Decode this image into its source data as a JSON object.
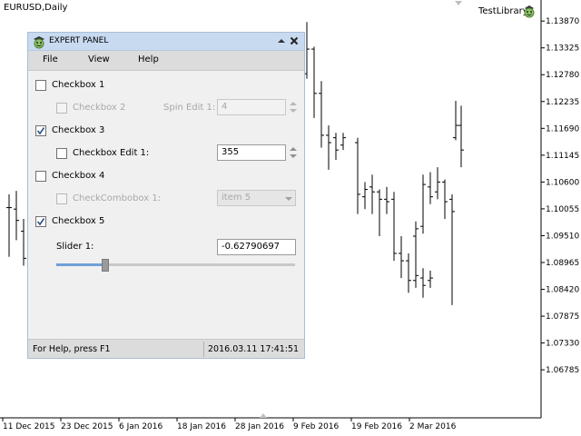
{
  "chart": {
    "symbol_label": "EURUSD,Daily",
    "library_label": "TestLibrary",
    "library_icon": "smiley-icon",
    "price_labels": [
      "1.13870",
      "1.13325",
      "1.12780",
      "1.12235",
      "1.11690",
      "1.11145",
      "1.10600",
      "1.10055",
      "1.09510",
      "1.08965",
      "1.08420",
      "1.07875",
      "1.07330",
      "1.06785"
    ],
    "date_labels": [
      "11 Dec 2015",
      "23 Dec 2015",
      "6 Jan 2016",
      "18 Jan 2016",
      "28 Jan 2016",
      "9 Feb 2016",
      "19 Feb 2016",
      "2 Mar 2016"
    ]
  },
  "chart_data": {
    "type": "ohlc",
    "title": "EURUSD,Daily",
    "ylim": [
      1.064,
      1.1415
    ],
    "x": [
      "11 Dec 2015",
      "23 Dec 2015",
      "6 Jan 2016",
      "18 Jan 2016",
      "28 Jan 2016",
      "9 Feb 2016",
      "19 Feb 2016",
      "2 Mar 2016"
    ],
    "bars": [
      {
        "o": 1.1008,
        "h": 1.1035,
        "l": 1.0908,
        "c": 1.1008
      },
      {
        "o": 1.1005,
        "h": 1.1042,
        "l": 1.0942,
        "c": 1.0982
      },
      {
        "o": 1.096,
        "h": 1.0985,
        "l": 1.089,
        "c": 1.0905
      },
      {
        "o": 1.09,
        "h": 1.096,
        "l": 1.088,
        "c": 1.0915
      },
      {
        "o": 1.079,
        "h": 1.081,
        "l": 1.0712,
        "c": 1.0735
      },
      {
        "o": 1.0745,
        "h": 1.079,
        "l": 1.071,
        "c": 1.076
      },
      {
        "o": 1.128,
        "h": 1.1385,
        "l": 1.127,
        "c": 1.133
      },
      {
        "o": 1.133,
        "h": 1.1335,
        "l": 1.119,
        "c": 1.124
      },
      {
        "o": 1.124,
        "h": 1.1265,
        "l": 1.113,
        "c": 1.1155
      },
      {
        "o": 1.1155,
        "h": 1.1175,
        "l": 1.1085,
        "c": 1.114
      },
      {
        "o": 1.115,
        "h": 1.116,
        "l": 1.1105,
        "c": 1.1125
      },
      {
        "o": 1.1135,
        "h": 1.116,
        "l": 1.1125,
        "c": 1.115
      },
      {
        "o": 1.114,
        "h": 1.115,
        "l": 1.0995,
        "c": 1.1035
      },
      {
        "o": 1.103,
        "h": 1.106,
        "l": 1.1005,
        "c": 1.1045
      },
      {
        "o": 1.105,
        "h": 1.1075,
        "l": 1.0995,
        "c": 1.104
      },
      {
        "o": 1.104,
        "h": 1.1045,
        "l": 1.095,
        "c": 1.1025
      },
      {
        "o": 1.1025,
        "h": 1.105,
        "l": 1.0995,
        "c": 1.102
      },
      {
        "o": 1.1025,
        "h": 1.104,
        "l": 1.09,
        "c": 1.0915
      },
      {
        "o": 1.0915,
        "h": 1.095,
        "l": 1.0865,
        "c": 1.09
      },
      {
        "o": 1.09,
        "h": 1.0915,
        "l": 1.0835,
        "c": 1.086
      },
      {
        "o": 1.086,
        "h": 1.0885,
        "l": 1.0845,
        "c": 1.087
      },
      {
        "o": 1.0865,
        "h": 1.0885,
        "l": 1.0825,
        "c": 1.085
      },
      {
        "o": 1.086,
        "h": 1.088,
        "l": 1.0845,
        "c": 1.0865
      },
      {
        "o": 1.095,
        "h": 1.098,
        "l": 1.088,
        "c": 1.0965
      },
      {
        "o": 1.097,
        "h": 1.1075,
        "l": 1.0955,
        "c": 1.1055
      },
      {
        "o": 1.105,
        "h": 1.108,
        "l": 1.1015,
        "c": 1.103
      },
      {
        "o": 1.104,
        "h": 1.109,
        "l": 1.1025,
        "c": 1.106
      },
      {
        "o": 1.106,
        "h": 1.1065,
        "l": 1.0985,
        "c": 1.102
      },
      {
        "o": 1.1025,
        "h": 1.1035,
        "l": 1.081,
        "c": 1.1
      },
      {
        "o": 1.115,
        "h": 1.1225,
        "l": 1.1145,
        "c": 1.1175
      },
      {
        "o": 1.1175,
        "h": 1.1215,
        "l": 1.109,
        "c": 1.1125
      }
    ]
  },
  "panel": {
    "title": "EXPERT PANEL",
    "menu": [
      "File",
      "View",
      "Help"
    ],
    "checkbox1": {
      "label": "Checkbox 1",
      "checked": false
    },
    "checkbox2": {
      "label": "Checkbox 2",
      "checked": false,
      "disabled": true
    },
    "spin_edit1": {
      "label": "Spin Edit 1:",
      "value": "4",
      "disabled": true
    },
    "checkbox3": {
      "label": "Checkbox 3",
      "checked": true
    },
    "checkbox_edit1": {
      "label": "Checkbox Edit 1:",
      "value": "355",
      "checked": false
    },
    "checkbox4": {
      "label": "Checkbox 4",
      "checked": false
    },
    "checkcombobox1": {
      "label": "CheckCombobox 1:",
      "value": "item 5",
      "disabled": true
    },
    "checkbox5": {
      "label": "Checkbox 5",
      "checked": true
    },
    "slider1": {
      "label": "Slider 1:",
      "value": "-0.62790697",
      "position": 0.19
    },
    "status_left": "For Help, press F1",
    "status_right": "2016.03.11 17:41:51"
  }
}
